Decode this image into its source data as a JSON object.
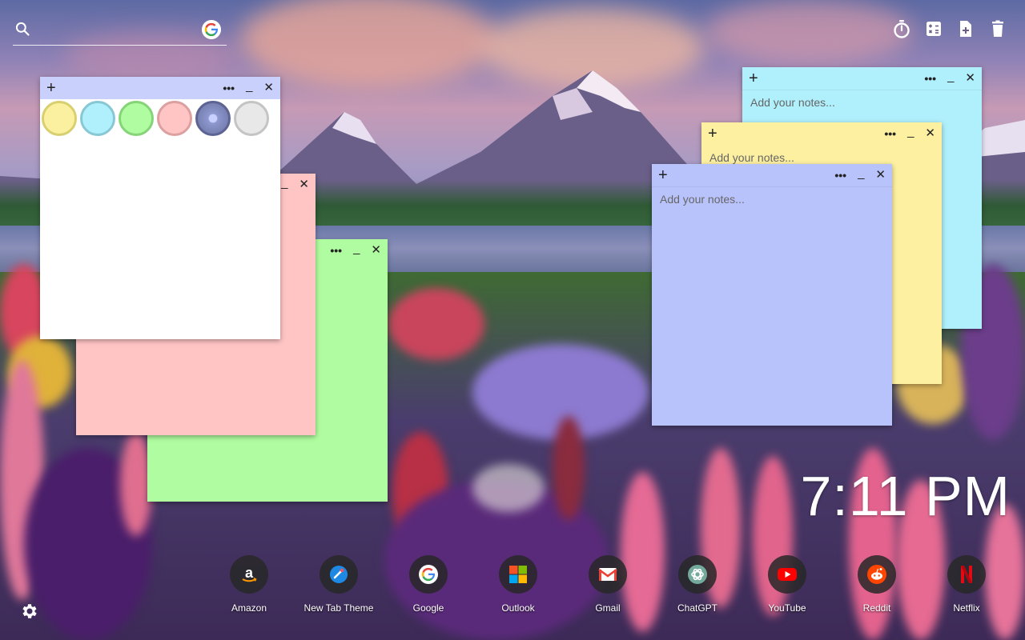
{
  "search": {
    "placeholder": "",
    "engine_icon": "google-icon"
  },
  "toolbar": {
    "icons": [
      "timer-icon",
      "calculator-icon",
      "add-note-icon",
      "trash-icon"
    ]
  },
  "notes": [
    {
      "id": "white",
      "color": "#ffffff",
      "bar_color": "#c9d0fb",
      "placeholder": "",
      "has_color_picker": true
    },
    {
      "id": "pink",
      "color": "#ffc5c5",
      "placeholder": ""
    },
    {
      "id": "green",
      "color": "#b0fca0",
      "placeholder": ""
    },
    {
      "id": "cyan",
      "color": "#b0f0fc",
      "placeholder": "Add your notes..."
    },
    {
      "id": "yellow",
      "color": "#fdf0a0",
      "placeholder": "Add your notes..."
    },
    {
      "id": "blue",
      "color": "#b9c3fb",
      "placeholder": "Add your notes..."
    }
  ],
  "note_controls": {
    "add": "+",
    "menu": "•••",
    "minimize": "_",
    "close": "✕"
  },
  "swatch_colors": [
    "#fbf0a0",
    "#b0f0fc",
    "#b0fca0",
    "#ffc5c5",
    "#7d86b8",
    "#e8e8e8"
  ],
  "clock": {
    "time": "7:11 PM"
  },
  "dock": [
    {
      "label": "Amazon",
      "icon": "amazon-icon"
    },
    {
      "label": "New Tab Theme",
      "icon": "new-tab-theme-icon"
    },
    {
      "label": "Google",
      "icon": "google-icon"
    },
    {
      "label": "Outlook",
      "icon": "microsoft-icon"
    },
    {
      "label": "Gmail",
      "icon": "gmail-icon"
    },
    {
      "label": "ChatGPT",
      "icon": "chatgpt-icon"
    },
    {
      "label": "YouTube",
      "icon": "youtube-icon"
    },
    {
      "label": "Reddit",
      "icon": "reddit-icon"
    },
    {
      "label": "Netflix",
      "icon": "netflix-icon"
    }
  ],
  "settings": {
    "icon": "gear-icon"
  }
}
